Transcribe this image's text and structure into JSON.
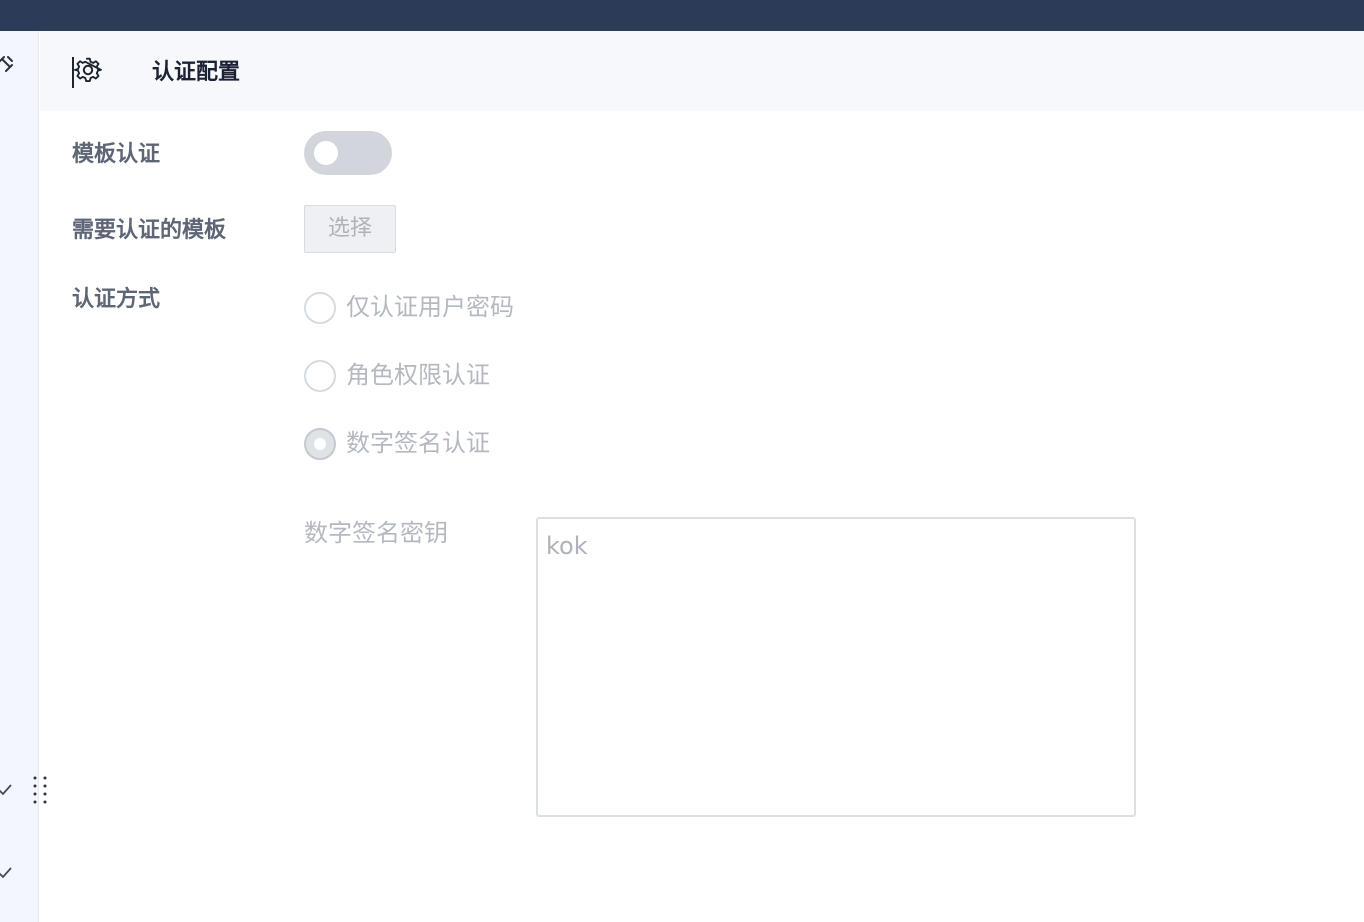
{
  "header": {
    "title": "认证配置"
  },
  "form": {
    "template_auth": {
      "label": "模板认证",
      "enabled": false
    },
    "templates_required": {
      "label": "需要认证的模板",
      "button_label": "选择"
    },
    "auth_method": {
      "label": "认证方式",
      "options": [
        {
          "label": "仅认证用户密码",
          "selected": false
        },
        {
          "label": "角色权限认证",
          "selected": false
        },
        {
          "label": "数字签名认证",
          "selected": true
        }
      ]
    },
    "signature_key": {
      "label": "数字签名密钥",
      "value": "kok"
    }
  },
  "icons": {
    "header": "gear-icon",
    "sidebar": [
      "unlink-icon",
      "drag-handle-icon",
      "checkmark-icon",
      "checkmark-icon"
    ]
  },
  "colors": {
    "topbar": "#2c3b57",
    "header_bg": "#f6f8fc",
    "label_text": "#5e6675",
    "disabled_text": "#b4b9c1"
  }
}
